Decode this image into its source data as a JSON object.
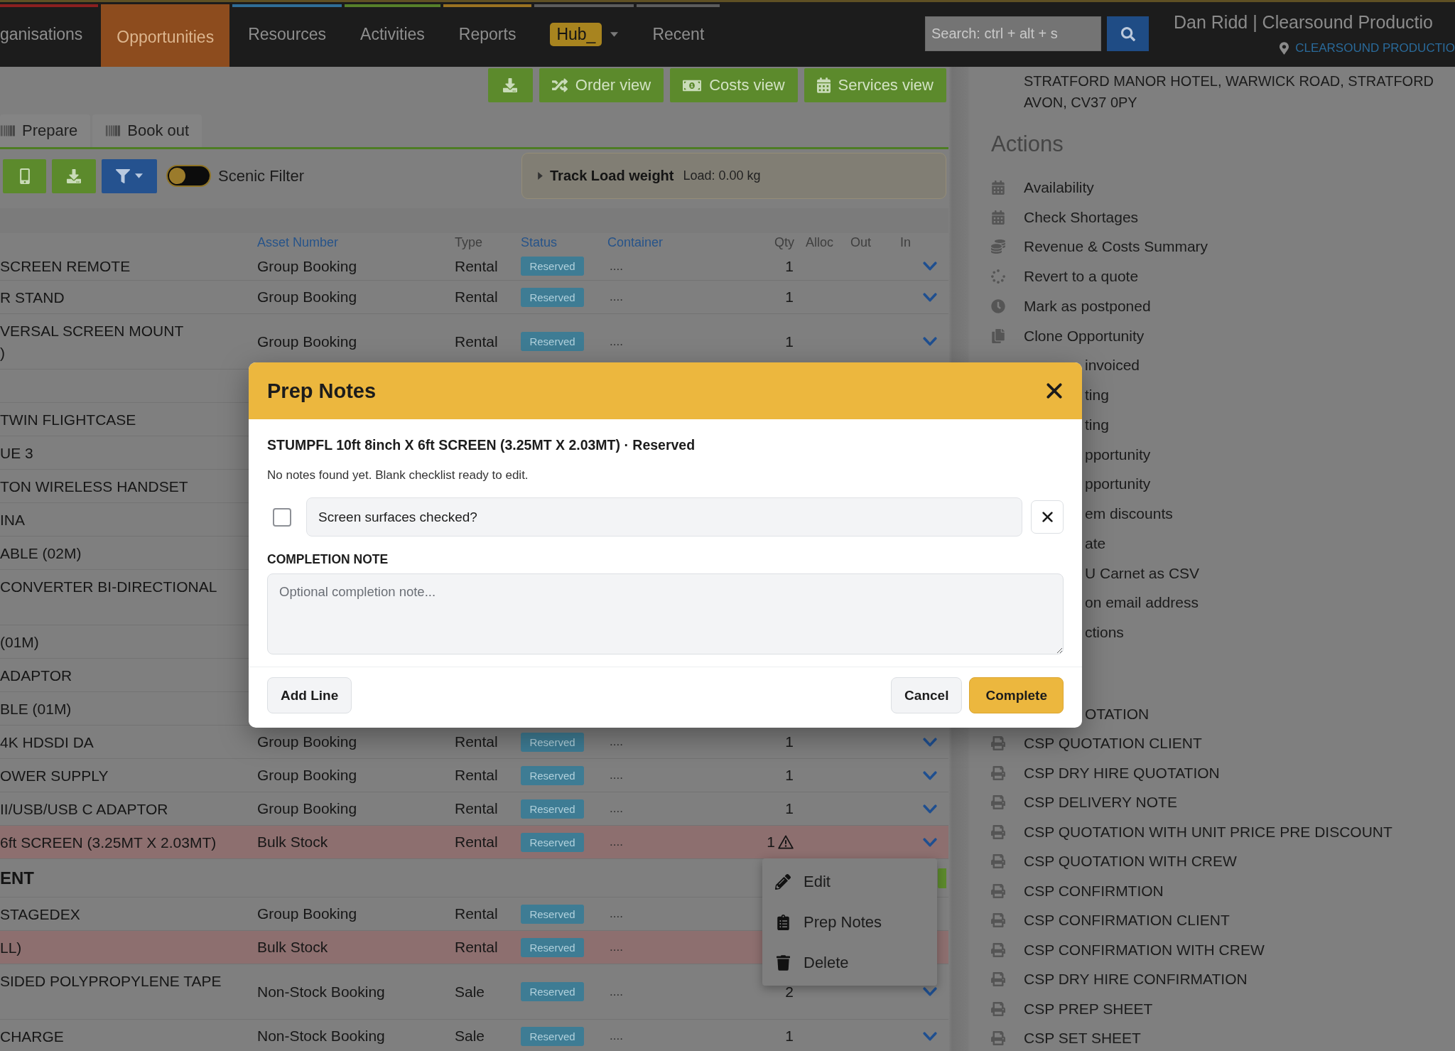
{
  "nav": {
    "items": [
      {
        "label": "ganisations",
        "kind": "tab",
        "selected": false,
        "color": "#8a2020"
      },
      {
        "label": "Opportunities",
        "kind": "tab",
        "selected": true,
        "color": "#8d4c1e"
      },
      {
        "label": "Resources",
        "kind": "tab",
        "selected": false,
        "color": "#2f6d97"
      },
      {
        "label": "Activities",
        "kind": "tab",
        "selected": false,
        "color": "#567f2a"
      },
      {
        "label": "Reports",
        "kind": "tab",
        "selected": false,
        "color": "#9a7222"
      },
      {
        "label": "Hub_",
        "kind": "badge",
        "selected": false,
        "color": "#5c5c5c"
      },
      {
        "label": "Recent",
        "kind": "tab",
        "selected": false,
        "color": "#5c5c5c"
      }
    ],
    "search": {
      "placeholder": "Search: ctrl + alt + s"
    },
    "user": "Dan Ridd | Clearsound Productio",
    "company": "CLEARSOUND PRODUCTIO"
  },
  "view_buttons": [
    {
      "label": "Order view"
    },
    {
      "label": "Costs view"
    },
    {
      "label": "Services view"
    }
  ],
  "mode_buttons": [
    {
      "label": "Prepare"
    },
    {
      "label": "Book out"
    }
  ],
  "toolbar": {
    "scenic_filter": {
      "label": "Scenic Filter",
      "on": false
    }
  },
  "track_load": {
    "title": "Track Load weight",
    "reading": "Load: 0.00 kg",
    "expanded": false
  },
  "table": {
    "columns": [
      {
        "label": "Asset Number",
        "link": true
      },
      {
        "label": "Type",
        "link": false
      },
      {
        "label": "Status",
        "link": true
      },
      {
        "label": "Container",
        "link": true
      },
      {
        "label": "Qty",
        "link": false
      },
      {
        "label": "Alloc",
        "link": false
      },
      {
        "label": "Out",
        "link": false
      },
      {
        "label": "In",
        "link": false
      }
    ],
    "rows": [
      {
        "kind": "item",
        "name": "SCREEN REMOTE",
        "asset_number": "Group Booking",
        "type": "Rental",
        "status": "Reserved",
        "container": "....",
        "qty": "1",
        "highlighted": false,
        "wrapped": false,
        "warning": false
      },
      {
        "kind": "item",
        "name": "R STAND",
        "asset_number": "Group Booking",
        "type": "Rental",
        "status": "Reserved",
        "container": "....",
        "qty": "1",
        "highlighted": false,
        "wrapped": false,
        "warning": false
      },
      {
        "kind": "item",
        "name": "VERSAL SCREEN MOUNT\n)",
        "asset_number": "Group Booking",
        "type": "Rental",
        "status": "Reserved",
        "container": "....",
        "qty": "1",
        "highlighted": false,
        "wrapped": true,
        "warning": false
      },
      {
        "kind": "blank"
      },
      {
        "kind": "item",
        "name": "TWIN FLIGHTCASE",
        "highlighted": false,
        "wrapped": false
      },
      {
        "kind": "item",
        "name": "UE 3",
        "highlighted": false,
        "wrapped": false
      },
      {
        "kind": "item",
        "name": "TON WIRELESS HANDSET",
        "highlighted": false,
        "wrapped": false
      },
      {
        "kind": "item",
        "name": "INA",
        "highlighted": false,
        "wrapped": false
      },
      {
        "kind": "item",
        "name": "ABLE (02M)",
        "highlighted": false,
        "wrapped": false
      },
      {
        "kind": "item",
        "name": "CONVERTER BI-DIRECTIONAL",
        "highlighted": false,
        "wrapped": true
      },
      {
        "kind": "item",
        "name": "(01M)",
        "highlighted": false,
        "wrapped": false
      },
      {
        "kind": "item",
        "name": "ADAPTOR",
        "highlighted": false,
        "wrapped": false
      },
      {
        "kind": "item",
        "name": "BLE (01M)",
        "highlighted": false,
        "wrapped": false
      },
      {
        "kind": "item",
        "name": "4K HDSDI DA",
        "asset_number": "Group Booking",
        "type": "Rental",
        "status": "Reserved",
        "container": "....",
        "qty": "1",
        "highlighted": false,
        "wrapped": false,
        "warning": false
      },
      {
        "kind": "item",
        "name": "OWER SUPPLY",
        "asset_number": "Group Booking",
        "type": "Rental",
        "status": "Reserved",
        "container": "....",
        "qty": "1",
        "highlighted": false,
        "wrapped": false,
        "warning": false
      },
      {
        "kind": "item",
        "name": "II/USB/USB C ADAPTOR",
        "asset_number": "Group Booking",
        "type": "Rental",
        "status": "Reserved",
        "container": "....",
        "qty": "1",
        "highlighted": false,
        "wrapped": false,
        "warning": false
      },
      {
        "kind": "item",
        "name": "6ft SCREEN (3.25MT X 2.03MT)",
        "asset_number": "Bulk Stock",
        "type": "Rental",
        "status": "Reserved",
        "container": "....",
        "qty": "1",
        "highlighted": true,
        "wrapped": false,
        "warning": true
      },
      {
        "kind": "group",
        "name": "ENT"
      },
      {
        "kind": "item",
        "name": "STAGEDEX",
        "asset_number": "Group Booking",
        "type": "Rental",
        "status": "Reserved",
        "container": "....",
        "highlighted": false,
        "wrapped": false
      },
      {
        "kind": "item",
        "name": "LL)",
        "asset_number": "Bulk Stock",
        "type": "Rental",
        "status": "Reserved",
        "container": "....",
        "highlighted": true,
        "wrapped": false
      },
      {
        "kind": "item",
        "name": "SIDED POLYPROPYLENE TAPE",
        "asset_number": "Non-Stock Booking",
        "type": "Sale",
        "status": "Reserved",
        "container": "....",
        "qty": "2",
        "highlighted": false,
        "wrapped": true,
        "warning": false
      },
      {
        "kind": "item",
        "name": "CHARGE",
        "asset_number": "Non-Stock Booking",
        "type": "Sale",
        "status": "Reserved",
        "container": "....",
        "qty": "1",
        "highlighted": false,
        "wrapped": false,
        "warning": false
      }
    ]
  },
  "context_menu": {
    "items": [
      {
        "label": "Edit"
      },
      {
        "label": "Prep Notes"
      },
      {
        "label": "Delete"
      }
    ]
  },
  "side_panel": {
    "address": [
      "STRATFORD MANOR HOTEL, WARWICK ROAD, STRATFORD",
      "AVON, CV37 0PY"
    ],
    "actions_title": "Actions",
    "actions": [
      {
        "label": "Availability",
        "partly_hidden": false
      },
      {
        "label": "Check Shortages",
        "partly_hidden": false
      },
      {
        "label": "Revenue & Costs Summary",
        "partly_hidden": false
      },
      {
        "label": "Revert to a quote",
        "partly_hidden": false
      },
      {
        "label": "Mark as postponed",
        "partly_hidden": false
      },
      {
        "label": "Clone Opportunity",
        "partly_hidden": false
      },
      {
        "label": "invoiced",
        "partly_hidden": true
      },
      {
        "label": "ting",
        "partly_hidden": true
      },
      {
        "label": "ting",
        "partly_hidden": true
      },
      {
        "label": "pportunity",
        "partly_hidden": true
      },
      {
        "label": "pportunity",
        "partly_hidden": true
      },
      {
        "label": "em discounts",
        "partly_hidden": true
      },
      {
        "label": "ate",
        "partly_hidden": true
      },
      {
        "label": "U Carnet as CSV",
        "partly_hidden": true
      },
      {
        "label": "on email address",
        "partly_hidden": true
      },
      {
        "label": "ctions",
        "partly_hidden": true
      }
    ],
    "documents": [
      {
        "label": "OTATION",
        "partly_hidden": true
      },
      {
        "label": "CSP QUOTATION CLIENT",
        "partly_hidden": false
      },
      {
        "label": "CSP DRY HIRE QUOTATION",
        "partly_hidden": false
      },
      {
        "label": "CSP DELIVERY NOTE",
        "partly_hidden": false
      },
      {
        "label": "CSP QUOTATION WITH UNIT PRICE PRE DISCOUNT",
        "partly_hidden": false
      },
      {
        "label": "CSP QUOTATION WITH CREW",
        "partly_hidden": false
      },
      {
        "label": "CSP CONFIRMTION",
        "partly_hidden": false
      },
      {
        "label": "CSP CONFIRMATION CLIENT",
        "partly_hidden": false
      },
      {
        "label": "CSP CONFIRMATION WITH CREW",
        "partly_hidden": false
      },
      {
        "label": "CSP DRY HIRE CONFIRMATION",
        "partly_hidden": false
      },
      {
        "label": "CSP PREP SHEET",
        "partly_hidden": false
      },
      {
        "label": "CSP SET SHEET",
        "partly_hidden": false
      }
    ]
  },
  "dialog": {
    "title": "Prep Notes",
    "item": "STUMPFL 10ft 8inch X 6ft SCREEN (3.25MT X 2.03MT) · Reserved",
    "message": "No notes found yet. Blank checklist ready to edit.",
    "checklist": [
      {
        "value": "Screen surfaces checked?",
        "checked": false
      }
    ],
    "note_label": "COMPLETION NOTE",
    "note_placeholder": "Optional completion note...",
    "buttons": [
      {
        "label": "Add Line",
        "kind": "secondary"
      },
      {
        "label": "Cancel",
        "kind": "secondary"
      },
      {
        "label": "Complete",
        "kind": "primary"
      }
    ]
  }
}
